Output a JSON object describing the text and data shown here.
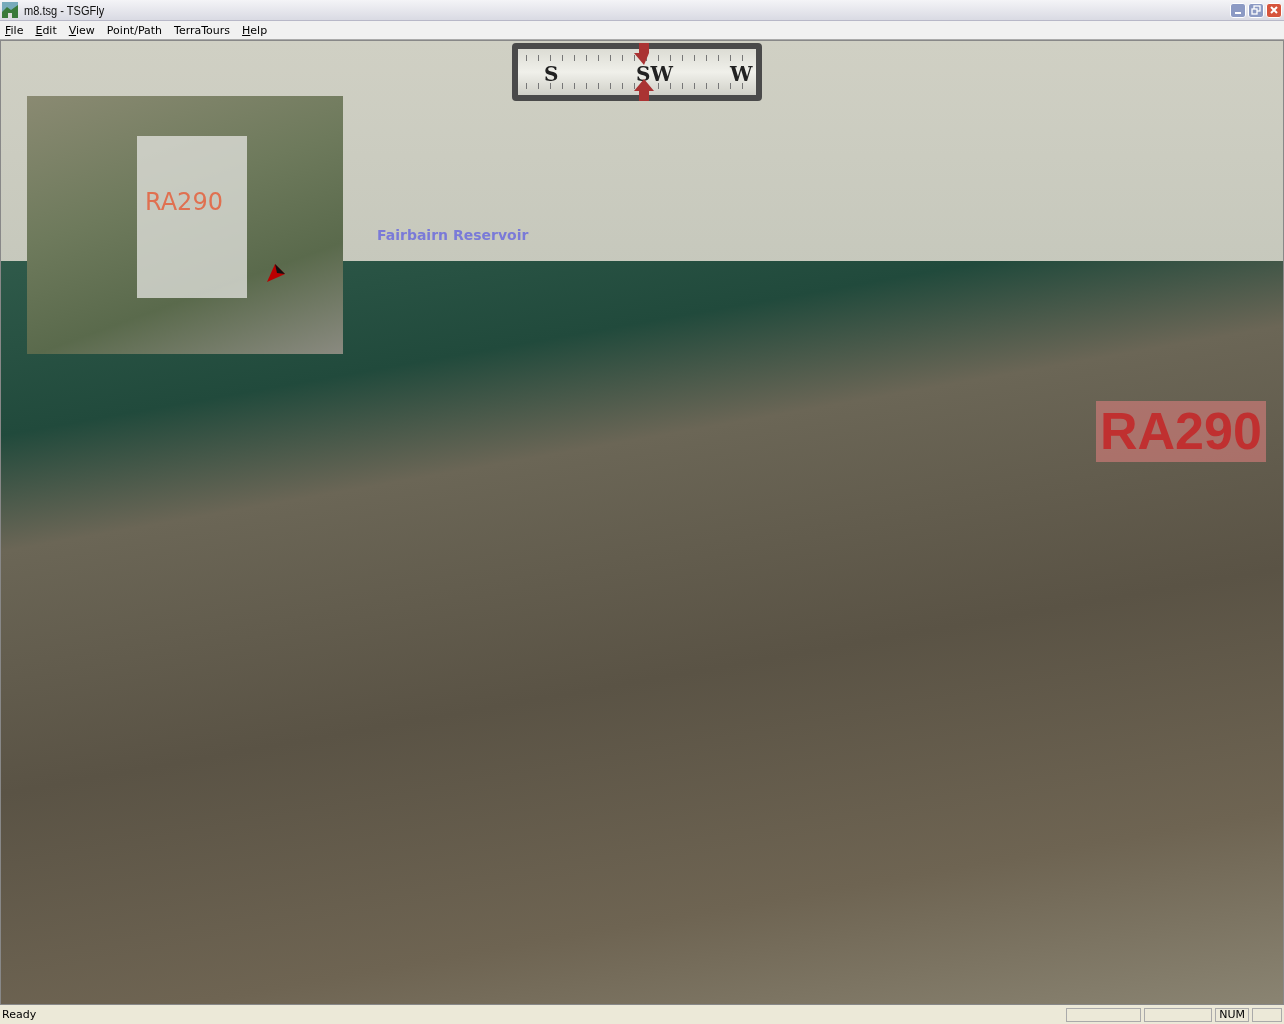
{
  "window": {
    "title": "m8.tsg - TSGFly"
  },
  "menu": [
    {
      "label": "File",
      "underline_first": true
    },
    {
      "label": "Edit",
      "underline_first": true
    },
    {
      "label": "View",
      "underline_first": true
    },
    {
      "label": "Point/Path",
      "underline_first": false
    },
    {
      "label": "TerraTours",
      "underline_first": false
    },
    {
      "label": "Help",
      "underline_first": true
    }
  ],
  "compass": {
    "left": "S",
    "center": "SW",
    "right": "W"
  },
  "overview_map": {
    "label": "RA290"
  },
  "scene_labels": [
    {
      "kind": "lake",
      "text": "Fairbairn Reservoir"
    },
    {
      "kind": "zone",
      "text": "RA290"
    }
  ],
  "status_bar": {
    "message": "Ready",
    "indicator": "NUM"
  }
}
